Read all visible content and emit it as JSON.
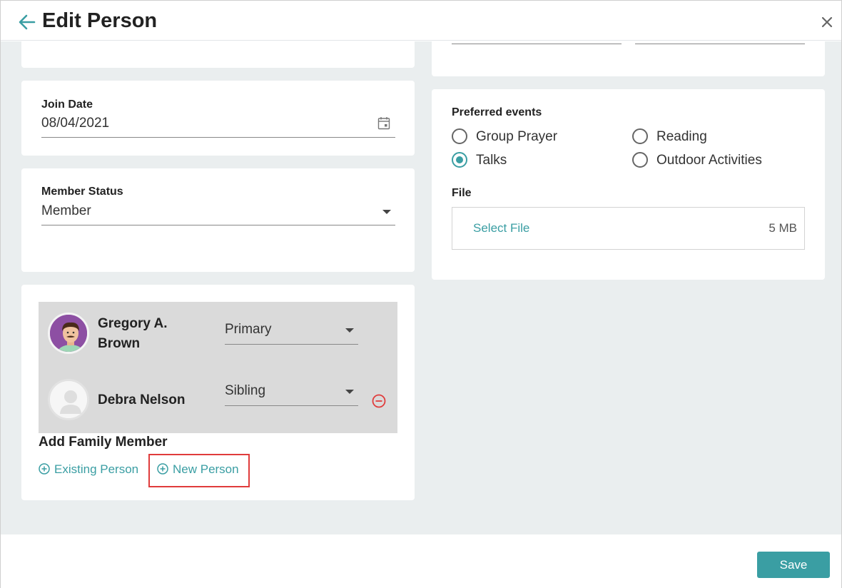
{
  "header": {
    "title": "Edit Person"
  },
  "join_date": {
    "label": "Join Date",
    "value": "08/04/2021"
  },
  "member_status": {
    "label": "Member Status",
    "value": "Member"
  },
  "family": {
    "members": [
      {
        "name_line1": "Gregory A.",
        "name_line2": "Brown",
        "relation": "Primary"
      },
      {
        "name": "Debra Nelson",
        "relation": "Sibling"
      }
    ],
    "add_label": "Add Family Member",
    "existing_person": "Existing Person",
    "new_person": "New Person"
  },
  "preferred_events": {
    "label": "Preferred events",
    "options": [
      {
        "label": "Group Prayer",
        "checked": false
      },
      {
        "label": "Reading",
        "checked": false
      },
      {
        "label": "Talks",
        "checked": true
      },
      {
        "label": "Outdoor Activities",
        "checked": false
      }
    ]
  },
  "file": {
    "label": "File",
    "select": "Select File",
    "size": "5 MB"
  },
  "footer": {
    "save": "Save"
  },
  "colors": {
    "accent": "#3a9ea3",
    "highlight": "#e03c3c",
    "remove": "#e03c3c",
    "background": "#eaeeef"
  }
}
